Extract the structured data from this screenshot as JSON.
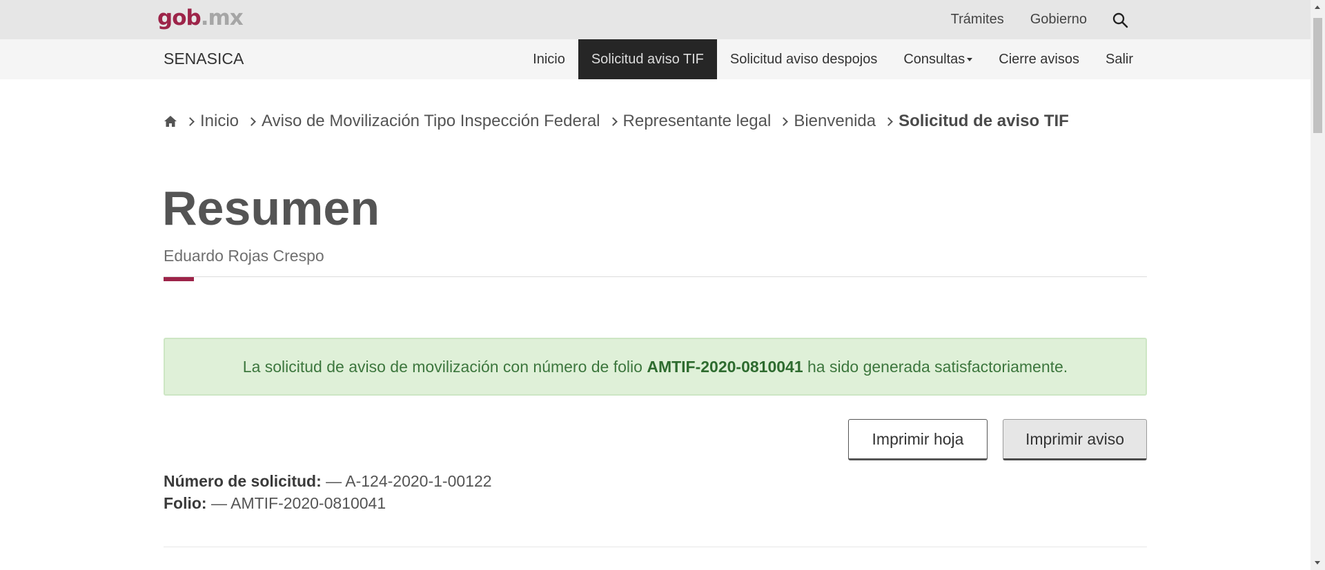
{
  "gob": {
    "logo_main": "gob",
    "logo_suffix": ".mx",
    "links": [
      "Trámites",
      "Gobierno"
    ],
    "search_icon": "search-icon"
  },
  "nav": {
    "brand": "SENASICA",
    "items": [
      {
        "label": "Inicio"
      },
      {
        "label": "Solicitud aviso TIF",
        "active": true
      },
      {
        "label": "Solicitud aviso despojos"
      },
      {
        "label": "Consultas"
      },
      {
        "label": "Cierre avisos"
      },
      {
        "label": "Salir"
      }
    ]
  },
  "breadcrumb": {
    "home_icon": "home-icon",
    "items": [
      "Inicio",
      "Aviso de Movilización Tipo Inspección Federal",
      "Representante legal",
      "Bienvenida"
    ],
    "current": "Solicitud de aviso TIF"
  },
  "page": {
    "title": "Resumen",
    "subtitle": "Eduardo Rojas Crespo"
  },
  "alert": {
    "prefix": "La solicitud de aviso de movilización con número de folio",
    "folio": "AMTIF-2020-0810041",
    "suffix": "ha sido generada satisfactoriamente."
  },
  "actions": {
    "print_sheet": "Imprimir hoja",
    "print_notice": "Imprimir aviso"
  },
  "summary": {
    "request_label": "Número de solicitud:",
    "request_value": "— A-124-2020-1-00122",
    "folio_label": "Folio:",
    "folio_value": "— AMTIF-2020-0810041"
  },
  "colors": {
    "accent": "#9d2449",
    "alert_bg": "#dff0d8",
    "alert_text": "#3c763d",
    "nav_active": "#262626"
  }
}
